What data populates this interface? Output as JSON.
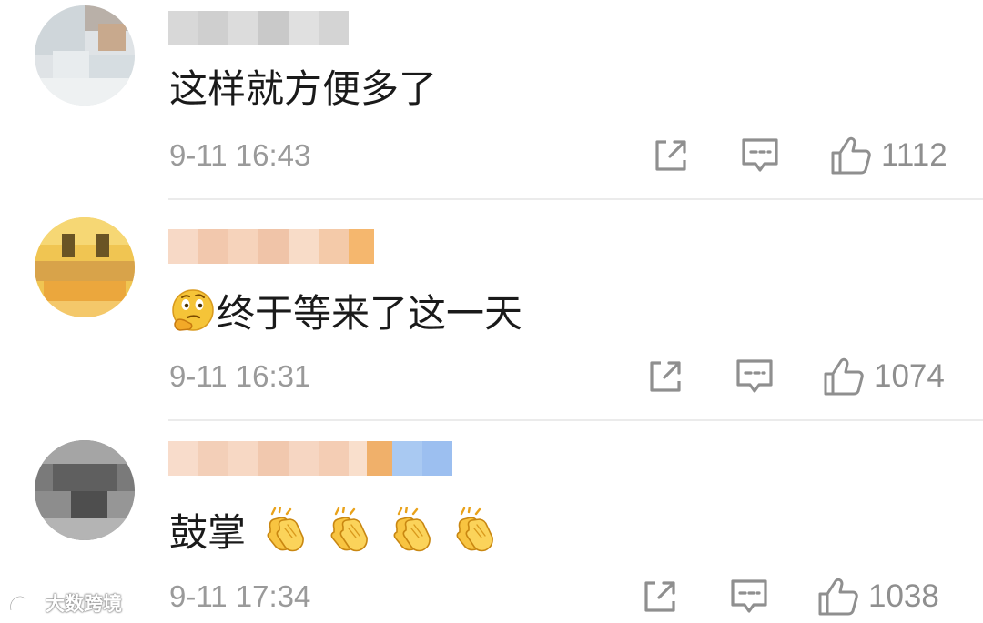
{
  "comments": [
    {
      "text": "这样就方便多了",
      "timestamp": "9-11 16:43",
      "likes": "1112",
      "username_blur_colors": [
        "#d8d8d8",
        "#cfcfcf",
        "#dcdcdc",
        "#c9c9c9",
        "#e0e0e0",
        "#d4d4d4"
      ]
    },
    {
      "emoji": "thinking-face",
      "text": "终于等来了这一天",
      "timestamp": "9-11 16:31",
      "likes": "1074",
      "username_blur_colors": [
        "#f7d9c6",
        "#f2c8ad",
        "#f6d3bb",
        "#f0c4a8",
        "#f8dcc8",
        "#f4caa9",
        "#f5b76e"
      ]
    },
    {
      "text": "鼓掌",
      "emoji_count": 4,
      "emoji": "clapping-hands",
      "timestamp": "9-11 17:34",
      "likes": "1038",
      "username_blur_colors": [
        "#f8dccb",
        "#f3cfb8",
        "#f7d8c4",
        "#f1c8ae",
        "#f6d6c2",
        "#f4cdb4",
        "#f9dfcc",
        "#f0b06a",
        "#a9c9f2",
        "#9cbff0"
      ]
    }
  ],
  "icons": {
    "share": "share-icon",
    "reply": "comment-icon",
    "like": "thumbs-up-icon"
  },
  "colors": {
    "text": "#1a1a1a",
    "meta": "#9a9a9a",
    "icon": "#8f8f8f",
    "divider": "#ebebeb"
  },
  "watermark": {
    "text": "大数跨境"
  }
}
